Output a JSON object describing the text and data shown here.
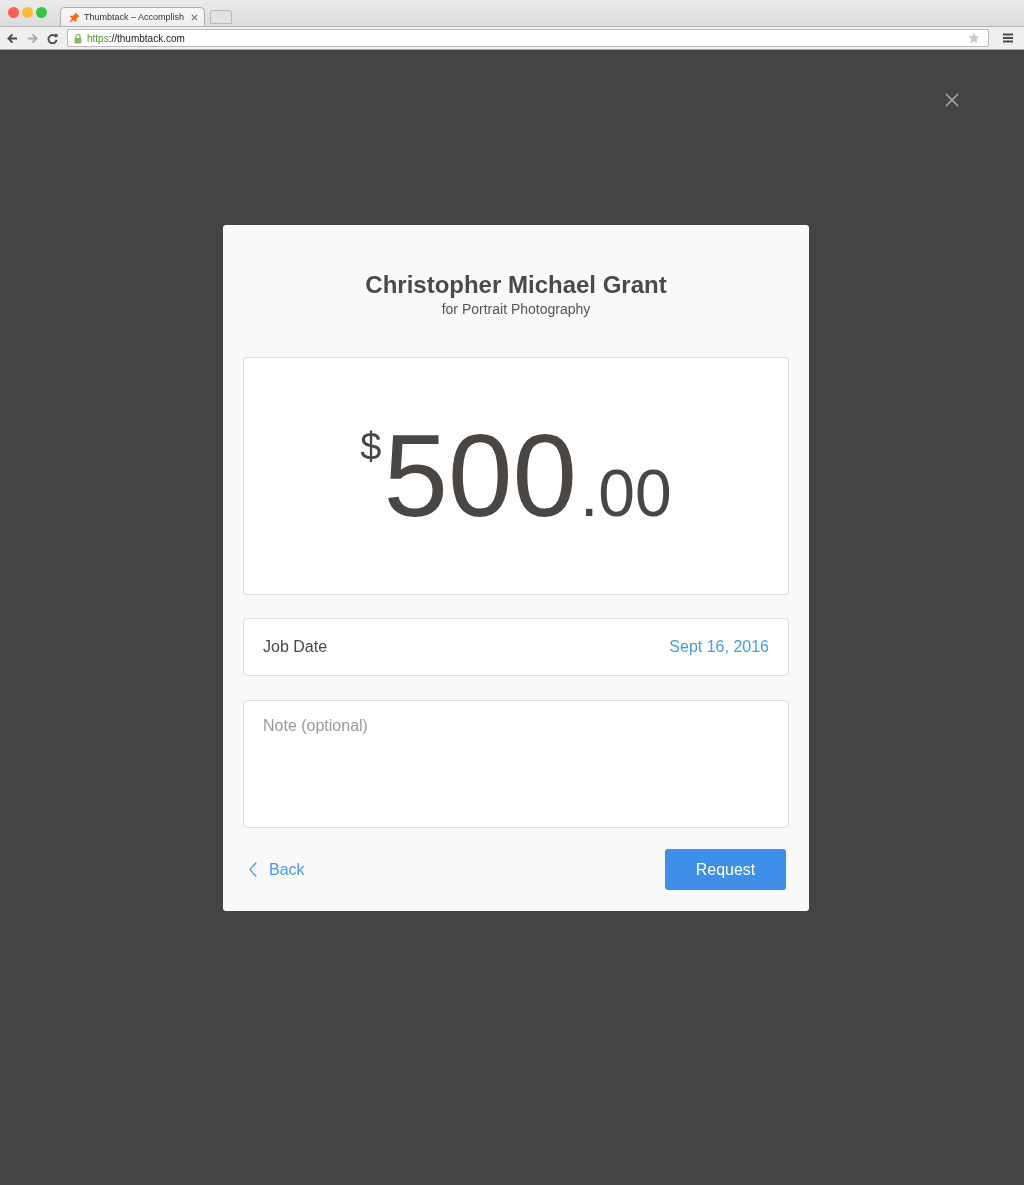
{
  "browser": {
    "tab": {
      "title": "Thumbtack – Accomplish",
      "selected": true
    },
    "url": {
      "scheme": "https",
      "rest": "://thumbtack.com"
    }
  },
  "dialog": {
    "title": "Christopher Michael Grant",
    "subtitle": "for Portrait Photography",
    "amount": {
      "currency": "$",
      "whole": "500",
      "separator": ".",
      "cents": "00"
    },
    "job_date": {
      "label": "Job Date",
      "value": "Sept 16, 2016"
    },
    "note": {
      "placeholder": "Note (optional)"
    },
    "back": "Back",
    "submit": "Request"
  }
}
